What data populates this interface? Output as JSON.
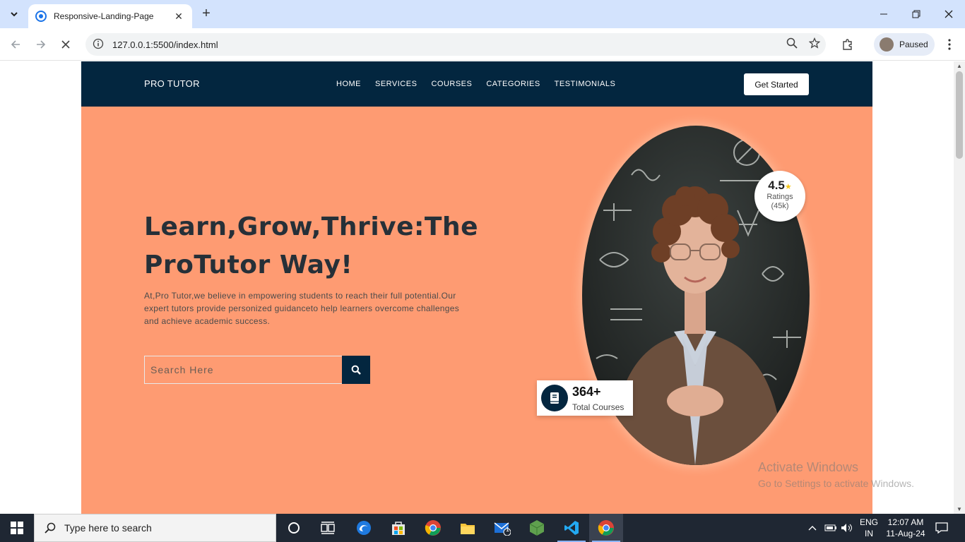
{
  "browser": {
    "tab_title": "Responsive-Landing-Page",
    "url": "127.0.0.1:5500/index.html",
    "profile_label": "Paused"
  },
  "site": {
    "brand": "PRO TUTOR",
    "menu": [
      "HOME",
      "SERVICES",
      "COURSES",
      "CATEGORIES",
      "TESTIMONIALS"
    ],
    "cta": "Get Started",
    "headline": "Learn,Grow,Thrive:The ProTutor Way!",
    "lead": "At,Pro Tutor,we believe in empowering students to reach their full potential.Our expert tutors provide personized guidanceto help learners overcome challenges and achieve academic success.",
    "search_placeholder": "Search Here",
    "rating_value": "4.5",
    "rating_label": "Ratings",
    "rating_count": "(45k)",
    "courses_value": "364+",
    "courses_label": "Total Courses",
    "accent_color": "#fe9b72",
    "nav_color": "#03263f"
  },
  "watermark": {
    "line1": "Activate Windows",
    "line2": "Go to Settings to activate Windows."
  },
  "taskbar": {
    "search_text": "Type here to search",
    "mail_badge": "1",
    "lang_line1": "ENG",
    "lang_line2": "IN",
    "time": "12:07 AM",
    "date": "11-Aug-24"
  }
}
